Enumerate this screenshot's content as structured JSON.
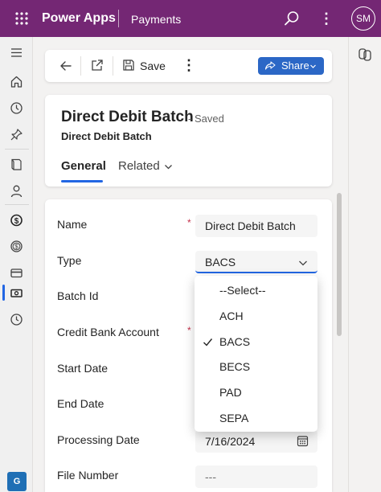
{
  "header": {
    "brand": "Power Apps",
    "app_name": "Payments",
    "avatar_initials": "SM",
    "color": "#742774"
  },
  "left_nav": {
    "items": [
      "menu-icon",
      "home-icon",
      "recent-icon",
      "pin-icon",
      "book-icon",
      "person-icon",
      "money-dollar-icon",
      "coin-dollar-icon",
      "card-icon",
      "cash-icon",
      "clock-icon"
    ],
    "active_item": "cash-icon",
    "environment_badge": "G"
  },
  "command_bar": {
    "save_label": "Save",
    "more_label": "⋮",
    "share_label": "Share"
  },
  "record": {
    "title": "Direct Debit Batch",
    "status": "- Saved",
    "entity": "Direct Debit Batch",
    "tabs": [
      {
        "label": "General",
        "active": true
      },
      {
        "label": "Related",
        "active": false
      }
    ]
  },
  "form": {
    "fields": [
      {
        "label": "Name",
        "required": true,
        "value": "Direct Debit Batch"
      },
      {
        "label": "Type",
        "required": false,
        "value": "BACS"
      },
      {
        "label": "Batch Id",
        "required": false,
        "value": ""
      },
      {
        "label": "Credit Bank Account",
        "required": true,
        "value": ""
      },
      {
        "label": "Start Date",
        "required": false,
        "value": ""
      },
      {
        "label": "End Date",
        "required": false,
        "value": ""
      },
      {
        "label": "Processing Date",
        "required": false,
        "value": "7/16/2024"
      },
      {
        "label": "File Number",
        "required": false,
        "value": "---"
      }
    ],
    "required_mark": "*"
  },
  "type_dropdown": {
    "options": [
      "--Select--",
      "ACH",
      "BACS",
      "BECS",
      "PAD",
      "SEPA"
    ],
    "selected": "BACS"
  },
  "accent_color": "#2266e3"
}
